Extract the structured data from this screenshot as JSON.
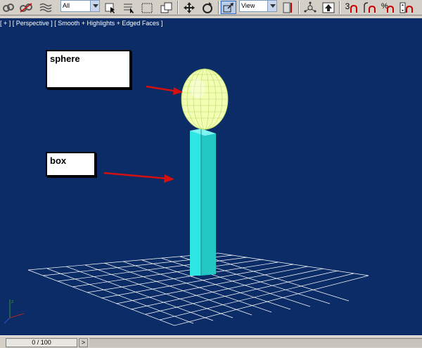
{
  "toolbar": {
    "selection_filter": "All",
    "reference_coord": "View",
    "snap_label": "3"
  },
  "viewport": {
    "label": "[ + ] [ Perspective ] [ Smooth + Highlights + Edged Faces ]"
  },
  "annotations": {
    "sphere_label": "sphere",
    "box_label": "box"
  },
  "timeline": {
    "frame_counter": "0 / 100",
    "next_label": ">"
  },
  "colors": {
    "viewport_bg": "#0b2c66",
    "box": "#2ee6e2",
    "sphere": "#f2ffb3",
    "arrow": "#d41010",
    "grid": "#ffffff"
  }
}
